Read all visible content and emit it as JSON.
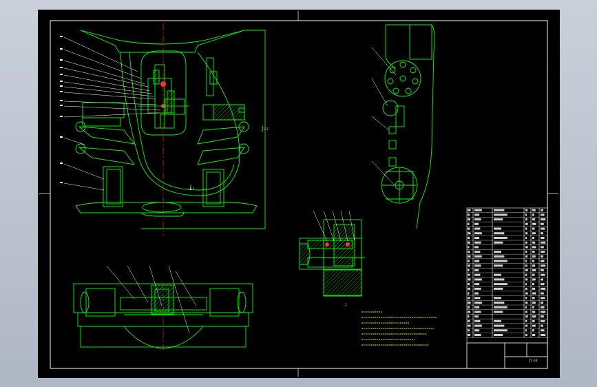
{
  "drawing": {
    "section_label": "I-I",
    "section_label_bottom": "I-I",
    "detail_label": "I",
    "title_block": {
      "drawing_number": "ZY-10"
    },
    "colors": {
      "sheet": "#000000",
      "geometry": "#00ff00",
      "frame": "#ffffff",
      "centerline": "#ff2020",
      "hatch": "#00ff00",
      "leaders": "#ffffff",
      "notes": "#e0e040"
    },
    "bom_rows": 28
  }
}
